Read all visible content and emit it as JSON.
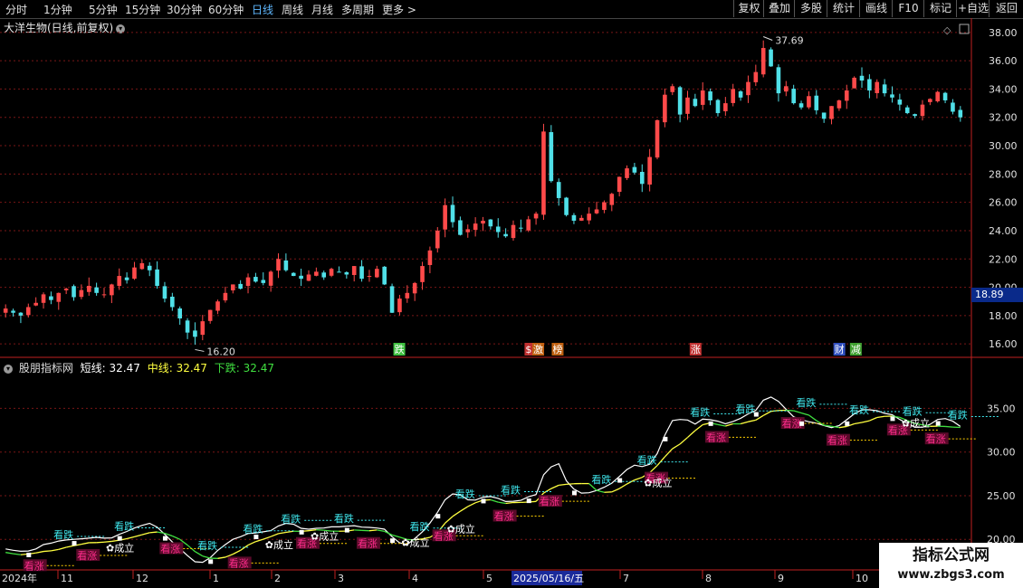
{
  "toolbar": {
    "timeframes": [
      "分时",
      "1分钟",
      "5分钟",
      "15分钟",
      "30分钟",
      "60分钟",
      "日线",
      "周线",
      "月线",
      "多周期",
      "更多 >"
    ],
    "active_timeframe": "日线",
    "right_buttons": [
      "复权",
      "叠加",
      "多股",
      "统计",
      "画线",
      "F10",
      "标记",
      "+自选",
      "返回"
    ]
  },
  "stock": {
    "title": "大洋生物(日线,前复权)",
    "high_label": "37.69",
    "low_label": "16.20",
    "current_price": "18.89"
  },
  "indicator": {
    "name": "股朋指标网",
    "short_line": "短线: 32.47",
    "mid_line": "中线: 32.47",
    "down_line": "下跌: 32.47",
    "signal_rise": "看涨",
    "signal_fall": "看跌",
    "signal_established": "✿成立"
  },
  "event_markers": [
    "跌",
    "$",
    "激",
    "榜",
    "涨",
    "财",
    "减"
  ],
  "time_axis": {
    "year_label": "2024年",
    "months": [
      "11",
      "12",
      "1",
      "2",
      "3",
      "4",
      "5",
      "6",
      "7",
      "8",
      "9",
      "10"
    ],
    "cursor_date": "2025/05/16/五"
  },
  "watermark": {
    "line1": "指标公式网",
    "line2": "www.zbgs3.com"
  },
  "chart_data": {
    "type": "candlestick",
    "upper_y_ticks": [
      "38.00",
      "36.00",
      "34.00",
      "32.00",
      "30.00",
      "28.00",
      "26.00",
      "24.00",
      "22.00",
      "20.00",
      "18.00",
      "16.00"
    ],
    "lower_y_ticks": [
      "35.00",
      "30.00",
      "25.00",
      "20.00"
    ],
    "upper_ylim": [
      15.5,
      38.5
    ],
    "lower_ylim": [
      16.5,
      39.5
    ],
    "series": [
      {
        "name": "price",
        "values": [
          18.5,
          18.2,
          18.0,
          18.6,
          18.9,
          19.5,
          19.1,
          19.6,
          19.9,
          19.3,
          19.8,
          20.1,
          19.6,
          19.5,
          20.2,
          20.8,
          20.5,
          21.4,
          21.7,
          21.2,
          20.1,
          19.2,
          18.6,
          17.8,
          16.8,
          16.5,
          17.6,
          18.4,
          19.0,
          19.6,
          20.2,
          19.9,
          20.7,
          20.4,
          20.3,
          21.1,
          22.0,
          21.2,
          20.8,
          20.6,
          20.9,
          21.1,
          20.7,
          21.3,
          21.1,
          20.9,
          21.5,
          20.6,
          20.8,
          21.3,
          20.2,
          18.2,
          19.2,
          19.6,
          20.3,
          21.5,
          22.6,
          24.0,
          25.8,
          24.6,
          23.7,
          24.1,
          24.5,
          24.7,
          24.3,
          23.9,
          23.6,
          24.4,
          24.2,
          24.8,
          25.2,
          31.0,
          27.5,
          26.3,
          25.1,
          24.7,
          24.9,
          25.2,
          25.5,
          26.0,
          26.6,
          27.8,
          28.4,
          28.1,
          27.3,
          29.2,
          31.8,
          33.6,
          34.2,
          32.2,
          33.4,
          32.8,
          33.9,
          33.2,
          32.3,
          33.0,
          34.0,
          33.4,
          34.5,
          35.2,
          36.9,
          35.6,
          33.7,
          34.2,
          33.0,
          32.7,
          33.5,
          32.5,
          31.9,
          32.8,
          33.2,
          33.9,
          34.8,
          34.6,
          33.9,
          34.5,
          33.7,
          33.4,
          32.9,
          32.3,
          32.1,
          32.9,
          33.3,
          33.8,
          33.2,
          32.4,
          32.0
        ]
      }
    ]
  },
  "colors": {
    "up": "#ff4a4a",
    "down": "#50e0e8",
    "short_line": "#ffffff",
    "mid_line": "#ffff40",
    "down_line": "#40e040",
    "signal_rise_bg": "#ff2d8c",
    "signal_fall_text": "#40e8ee"
  }
}
